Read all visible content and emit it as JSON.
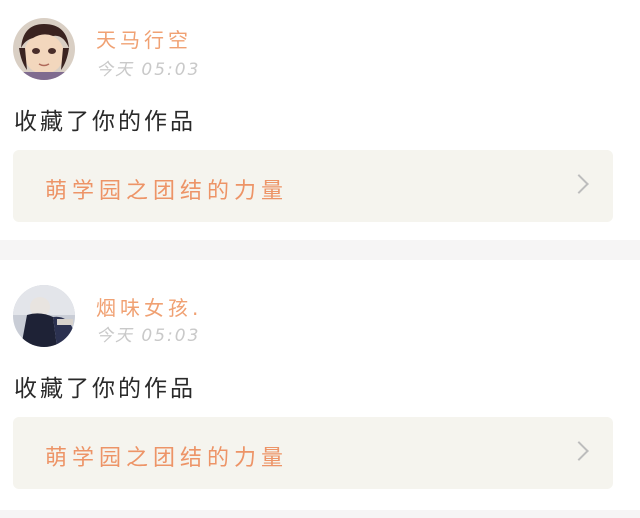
{
  "notifications": [
    {
      "user": {
        "name": "天马行空",
        "avatar_icon": "user-avatar-icon"
      },
      "time": "今天 05:03",
      "action": "收藏了你的作品",
      "work": {
        "title": "萌学园之团结的力量",
        "chevron_icon": "chevron-right-icon"
      }
    },
    {
      "user": {
        "name": "烟味女孩.",
        "avatar_icon": "user-avatar-icon"
      },
      "time": "今天 05:03",
      "action": "收藏了你的作品",
      "work": {
        "title": "萌学园之团结的力量",
        "chevron_icon": "chevron-right-icon"
      }
    }
  ],
  "colors": {
    "username": "#f0a173",
    "work_title": "#ed9467",
    "time": "#c9c9c9",
    "action": "#2a2a2a",
    "work_card_bg": "#f5f4ee",
    "divider": "#f6f5f5"
  }
}
